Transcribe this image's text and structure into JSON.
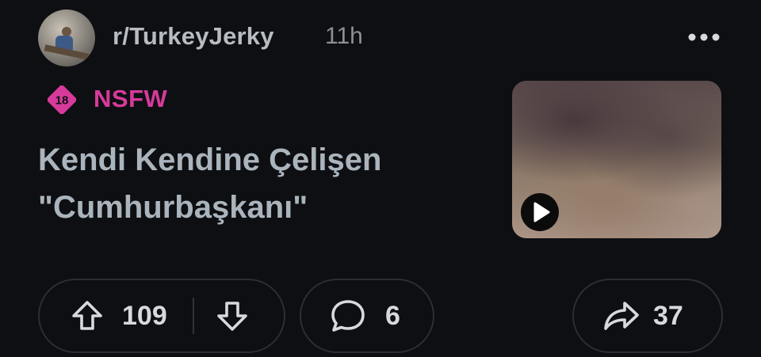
{
  "post": {
    "subreddit": "r/TurkeyJerky",
    "time": "11h",
    "nsfw_badge": "18",
    "nsfw_label": "NSFW",
    "title": "Kendi Kendine Çelişen \"Cumhurbaşkanı\"",
    "thumbnail": "blurred video thumbnail",
    "icons": [
      "more-icon",
      "nsfw-18-icon",
      "play-icon",
      "upvote-icon",
      "downvote-icon",
      "comment-icon",
      "share-icon"
    ]
  },
  "actions": {
    "upvotes": "109",
    "comments": "6",
    "shares": "37"
  },
  "colors": {
    "background": "#0e0f12",
    "nsfw": "#d63a9b",
    "title": "#aab4bd",
    "pill_border": "#2b2e33"
  }
}
